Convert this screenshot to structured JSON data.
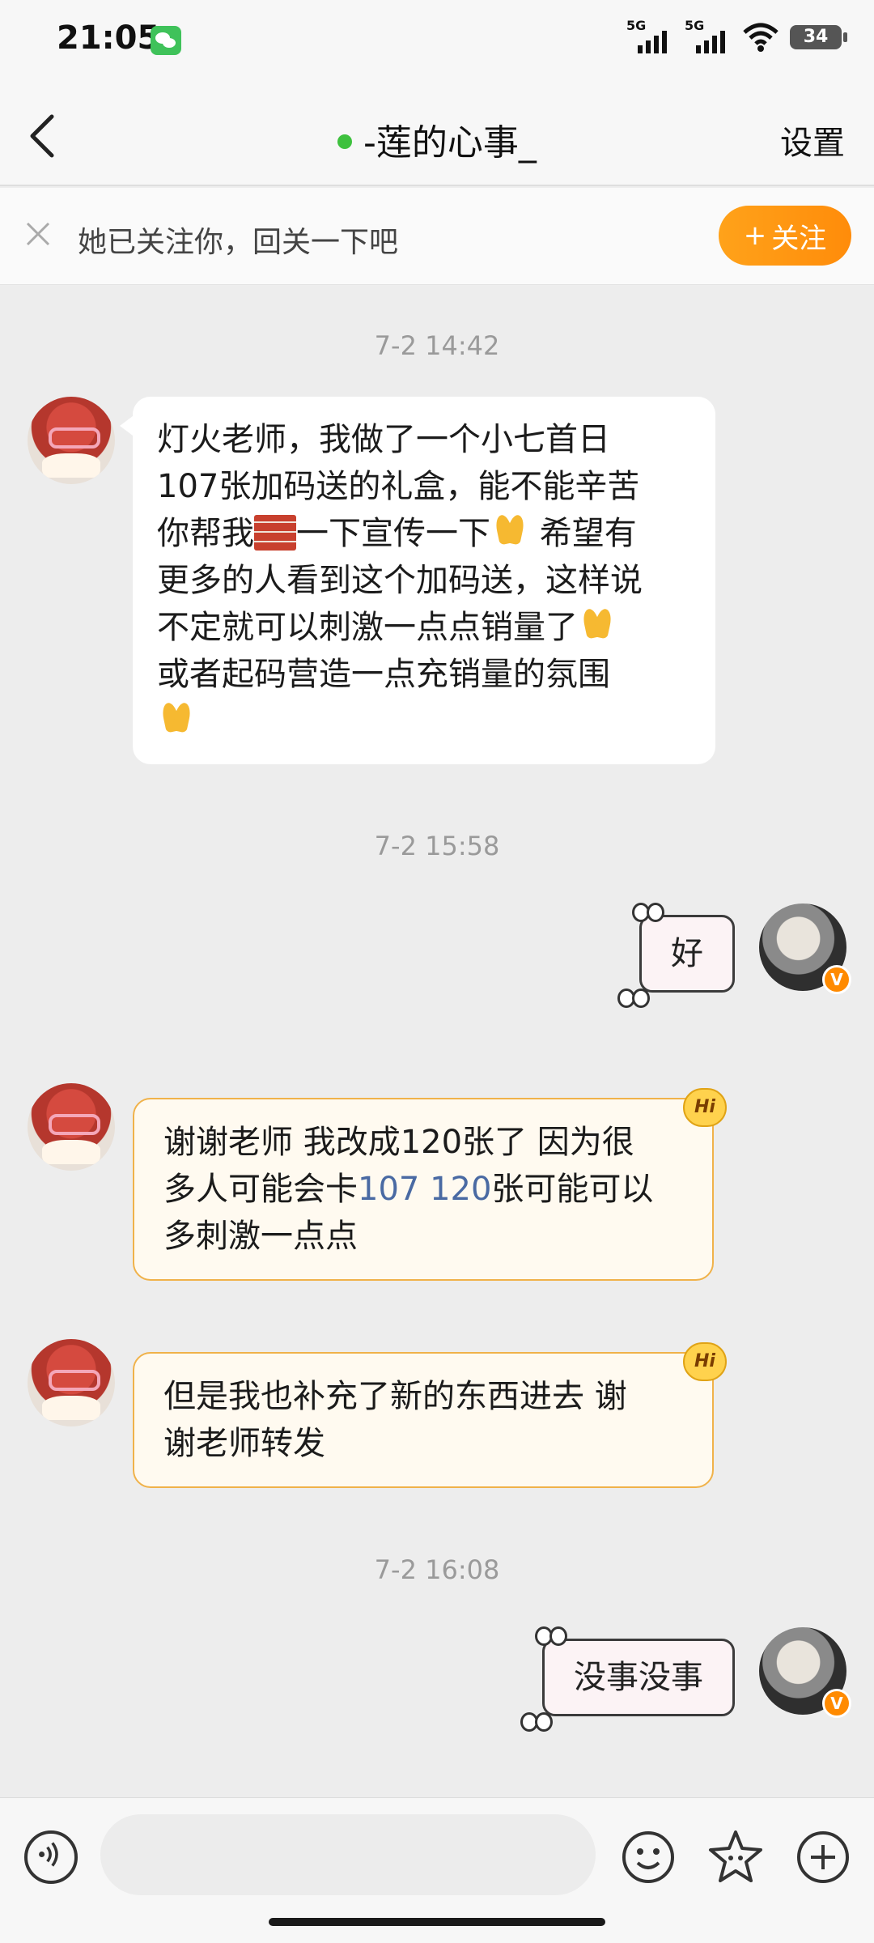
{
  "status_bar": {
    "time": "21:05",
    "signal_1": "5G",
    "signal_2": "5G",
    "battery": "34"
  },
  "nav": {
    "title": "-莲的心事_",
    "settings_label": "设置"
  },
  "follow_prompt": {
    "text": "她已关注你，回关一下吧",
    "button_label": "关注",
    "button_plus": "+"
  },
  "messages": {
    "ts1": "7-2 14:42",
    "m1_line1": "灯火老师，我做了一个小七首日",
    "m1_line2": "107张加码送的礼盒，能不能辛苦",
    "m1_line3a": "你帮我",
    "m1_line3b": "一下宣传一下",
    "m1_line3c": " 希望有",
    "m1_line4": "更多的人看到这个加码送，这样说",
    "m1_line5": "不定就可以刺激一点点销量了",
    "m1_line6": "或者起码营造一点充销量的氛围",
    "ts2": "7-2 15:58",
    "m2": "好",
    "m3_line1": "谢谢老师 我改成120张了 因为很",
    "m3_line2a": "多人可能会卡",
    "m3_line2_link": "107 120",
    "m3_line2b": "张可能可以",
    "m3_line3": "多刺激一点点",
    "m4_line1": "但是我也补充了新的东西进去 谢",
    "m4_line2": "谢老师转发",
    "ts3": "7-2 16:08",
    "m5": "没事没事",
    "hi_badge": "Hi",
    "verified_badge": "V"
  },
  "input": {
    "placeholder": ""
  },
  "colors": {
    "accent_orange": "#ff8c0a",
    "online_green": "#3ec13e",
    "link_blue": "#4a6aa3"
  }
}
